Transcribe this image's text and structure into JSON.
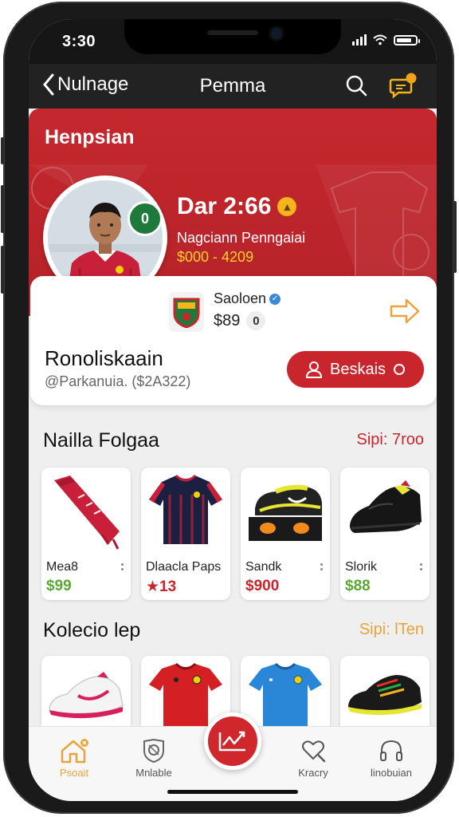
{
  "status_bar": {
    "time": "3:30"
  },
  "nav": {
    "back_label": "Nulnage",
    "title": "Pemma"
  },
  "hero": {
    "section_title": "Henpsian",
    "stat_value": "Dar 2:66",
    "subtitle": "Nagciann Penngaiai",
    "range": "$000 - 4209",
    "club_badge_text": "0"
  },
  "profile": {
    "team_name": "Saoloen",
    "team_price": "$89",
    "team_price_badge": "0",
    "user_name": "Ronoliskaain",
    "user_handle": "@Parkanuia. ($2A322)",
    "follow_label": "Beskais"
  },
  "featured": {
    "title": "Nailla Folgaa",
    "link": "Sipi: 7roo",
    "items": [
      {
        "name": "Mea8",
        "price": "$99",
        "price_color": "#5aa832",
        "icon": "scarf-icon"
      },
      {
        "name": "Dlaacla Paps",
        "price": "★13",
        "price_color": "#c8262c",
        "icon": "jersey-icon"
      },
      {
        "name": "Sandk",
        "price": "$900",
        "price_color": "#c8262c",
        "icon": "boot-icon"
      },
      {
        "name": "Slorik",
        "price": "$88",
        "price_color": "#5aa832",
        "icon": "shoe-icon"
      }
    ]
  },
  "collection": {
    "title": "Kolecio lep",
    "link": "Sipi: lTen",
    "items": [
      {
        "icon": "sneaker-icon"
      },
      {
        "icon": "red-jersey-icon"
      },
      {
        "icon": "blue-jersey-icon"
      },
      {
        "icon": "cleat-icon"
      }
    ]
  },
  "tabs": [
    {
      "label": "Psoait",
      "icon": "home-icon",
      "active": true
    },
    {
      "label": "Mnlable",
      "icon": "shield-icon",
      "active": false
    },
    {
      "label": "Kracry",
      "icon": "heart-search-icon",
      "active": false
    },
    {
      "label": "linobuian",
      "icon": "headphones-icon",
      "active": false
    }
  ],
  "colors": {
    "brand_red": "#c8262c",
    "accent_yellow": "#f4b41c",
    "active_tab": "#e8a43a"
  }
}
